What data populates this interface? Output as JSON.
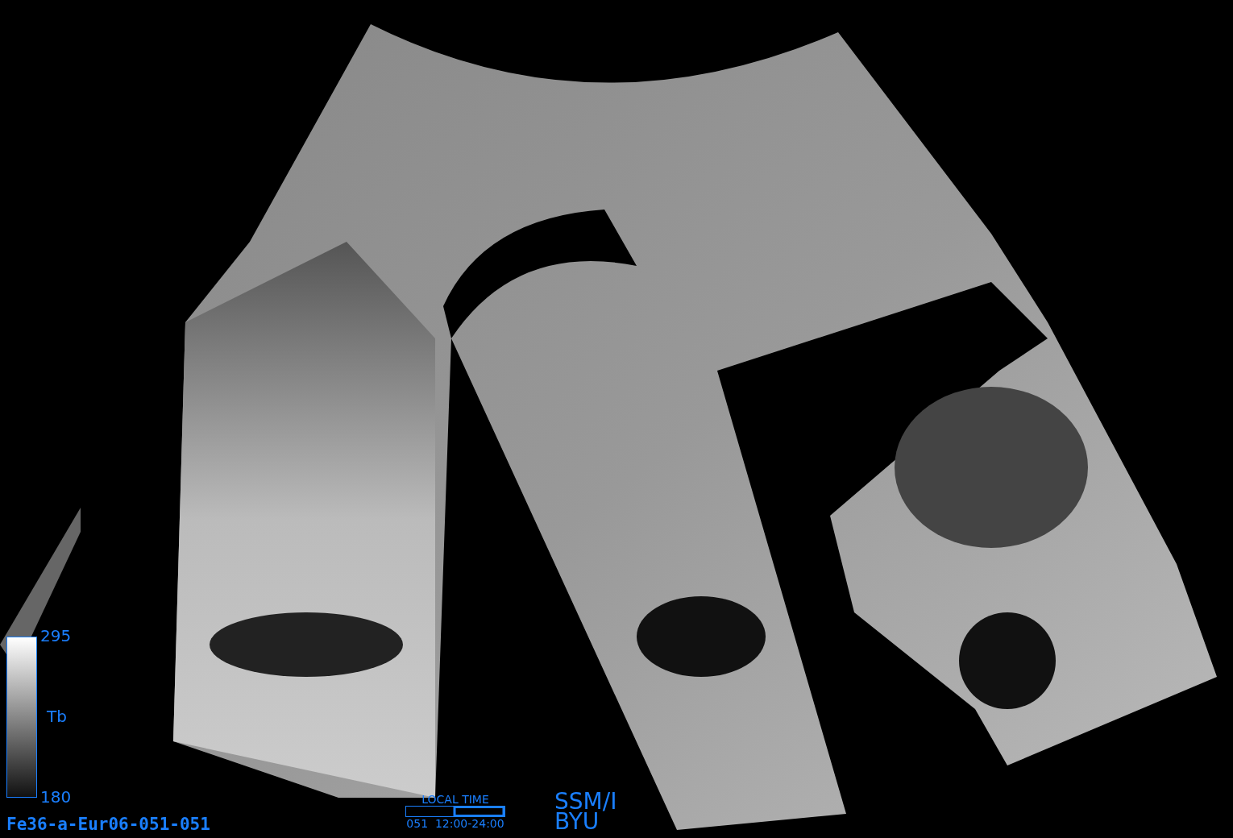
{
  "colorbar": {
    "max": "295",
    "label": "Tb",
    "min": "180"
  },
  "time": {
    "title": "LOCAL TIME",
    "range": "051  12:00-24:00"
  },
  "sensor": {
    "name": "SSM/I",
    "source": "BYU"
  },
  "image_id": "Fe36-a-Eur06-051-051"
}
